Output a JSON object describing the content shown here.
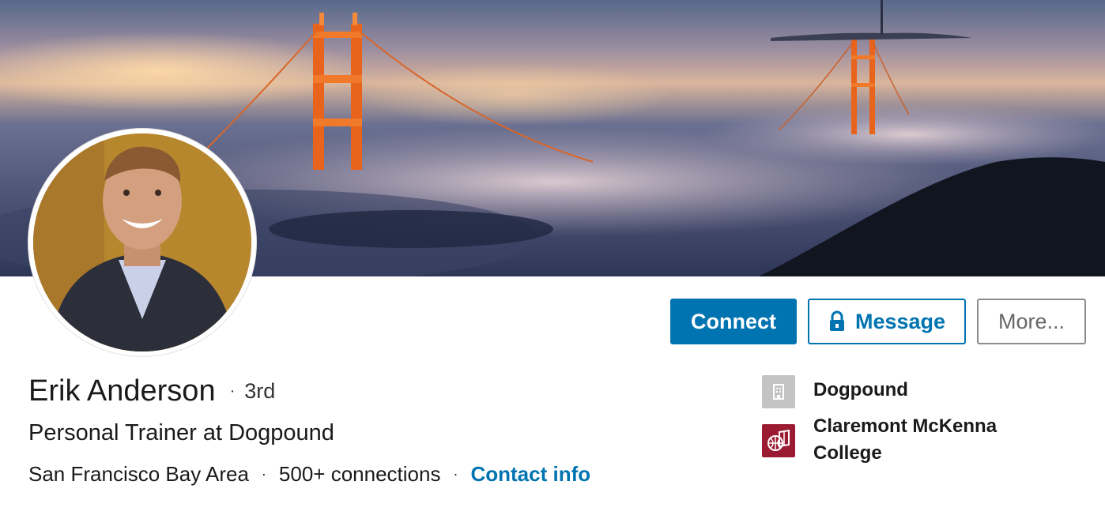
{
  "profile": {
    "name": "Erik Anderson",
    "degree_separator": "·",
    "degree": "3rd",
    "headline": "Personal Trainer at Dogpound",
    "location": "San Francisco Bay Area",
    "connections": "500+ connections",
    "contact_label": "Contact info",
    "separator": "·"
  },
  "actions": {
    "connect_label": "Connect",
    "message_label": "Message",
    "more_label": "More..."
  },
  "organizations": [
    {
      "name": "Dogpound",
      "icon": "building-icon"
    },
    {
      "name": "Claremont McKenna College",
      "icon": "college-logo-icon"
    }
  ],
  "colors": {
    "accent": "#0073b1",
    "college_logo": "#9a1b32"
  }
}
